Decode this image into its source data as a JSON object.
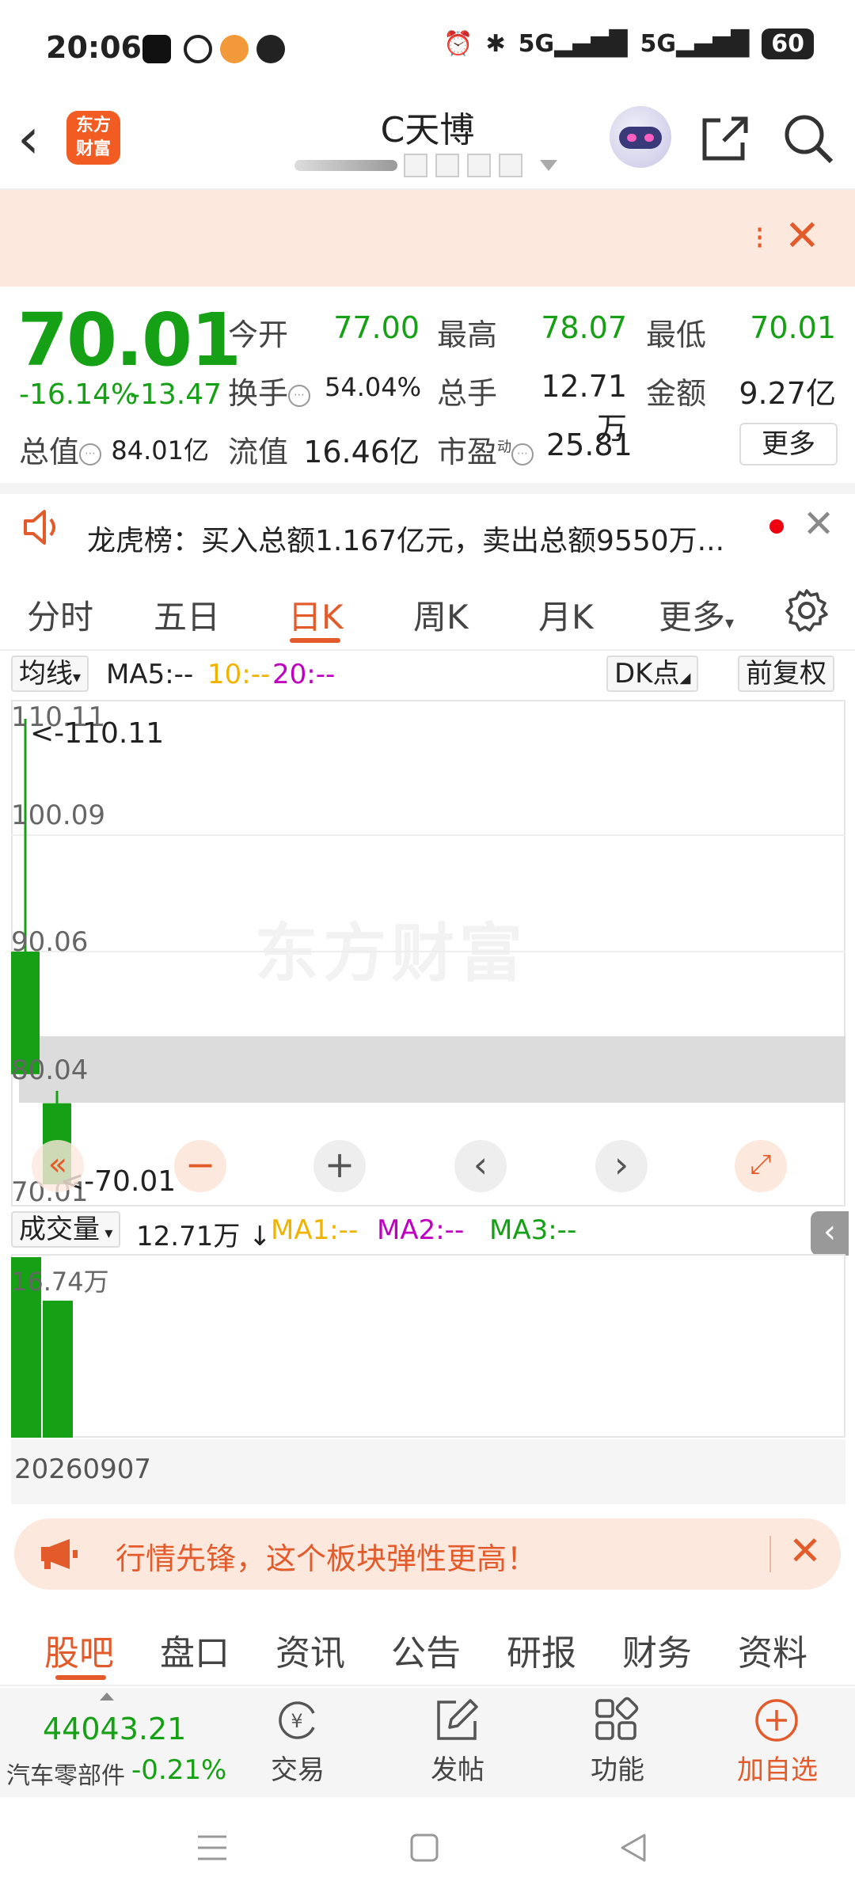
{
  "status_bar": {
    "time": "20:06",
    "battery": "60",
    "signal1": "5G",
    "signal2": "5G"
  },
  "header": {
    "stock_name": "C天博",
    "logo_line1": "东方",
    "logo_line2": "财富"
  },
  "quote": {
    "price": "70.01",
    "change_pct": "-16.14%",
    "change_abs": "-13.47",
    "open_label": "今开",
    "open": "77.00",
    "high_label": "最高",
    "high": "78.07",
    "low_label": "最低",
    "low": "70.01",
    "turnover_label": "换手",
    "turnover": "54.04%",
    "volume_label": "总手",
    "volume": "12.71万",
    "amount_label": "金额",
    "amount": "9.27亿",
    "mktcap_label": "总值",
    "mktcap": "84.01亿",
    "float_label": "流值",
    "float": "16.46亿",
    "pe_label": "市盈",
    "pe_sup": "动",
    "pe": "25.81",
    "more_label": "更多"
  },
  "notice": {
    "text": "龙虎榜：买入总额1.167亿元，卖出总额9550万..."
  },
  "chart_tabs": [
    "分时",
    "五日",
    "日K",
    "周K",
    "月K",
    "更多"
  ],
  "chart_toolbar": {
    "indicator": "均线",
    "ma5": "MA5:--",
    "ma10": "10:--",
    "ma20": "20:--",
    "dk": "DK点",
    "adjust": "前复权"
  },
  "price_axis": [
    "110.11",
    "100.09",
    "90.06",
    "80.04",
    "70.01"
  ],
  "annotations": {
    "high": "<-110.11",
    "low": "<-70.01"
  },
  "chart_data": {
    "type": "candlestick",
    "ylim": [
      70.01,
      110.11
    ],
    "candles": [
      {
        "open": 90.06,
        "close": 79.5,
        "high": 110.11,
        "low": 79.5
      },
      {
        "open": 77.0,
        "close": 70.01,
        "high": 78.07,
        "low": 70.01
      }
    ],
    "volume": [
      16.74,
      12.71
    ],
    "volume_max_label": "16.74万",
    "last_date": "20260907"
  },
  "volume_toolbar": {
    "label": "成交量",
    "value": "12.71万 ↓",
    "ma1": "MA1:--",
    "ma2": "MA2:--",
    "ma3": "MA3:--"
  },
  "promo": {
    "text": "行情先锋，这个板块弹性更高！"
  },
  "bottom_tabs": [
    "股吧",
    "盘口",
    "资讯",
    "公告",
    "研报",
    "财务",
    "资料"
  ],
  "bottom_bar": {
    "index_value": "44043.21",
    "sector": "汽车零部件",
    "sector_change": "-0.21%",
    "trade": "交易",
    "post": "发帖",
    "function": "功能",
    "add": "加自选"
  },
  "colors": {
    "down": "#16a016",
    "accent": "#e35b2b",
    "ma10": "#f0b400",
    "ma20": "#c000c0"
  }
}
